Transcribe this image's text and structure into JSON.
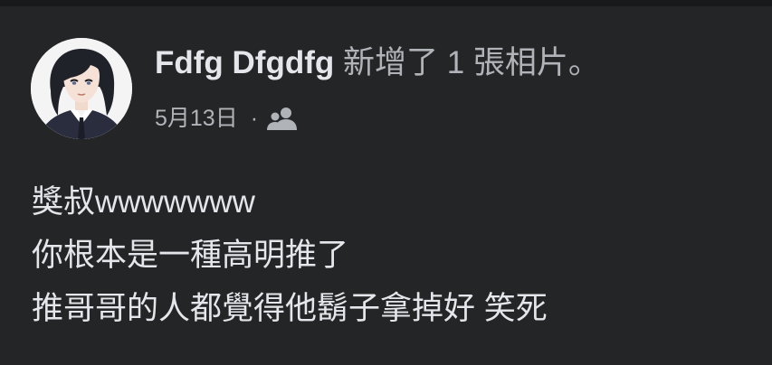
{
  "post": {
    "author": "Fdfg Dfgdfg",
    "action": "新增了 1 張相片。",
    "date": "5月13日",
    "separator": "·",
    "audience_icon": "friends-icon",
    "lines": [
      "獎叔wwwwwww",
      "你根本是一種高明推了",
      "推哥哥的人都覺得他鬍子拿掉好 笑死"
    ]
  },
  "colors": {
    "background": "#242526",
    "top_strip": "#18191a",
    "primary_text": "#e4e6eb",
    "secondary_text": "#b0b3b8"
  }
}
